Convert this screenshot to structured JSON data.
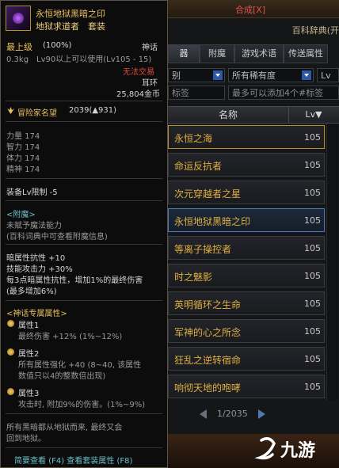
{
  "right_panel": {
    "title": "合成[X]",
    "subtitle": "百科辞典(开",
    "tabs": [
      "器",
      "附魔",
      "游戏术语",
      "传送属性"
    ],
    "filter_left": "别",
    "filter_mid": "所有稀有度",
    "filter_right": "Lv",
    "search_left": "标签",
    "search_right": "最多可以添加4个#标签",
    "col_name": "名称",
    "col_lv": "Lv▼",
    "rows": [
      {
        "name": "永恒之海",
        "lv": "105"
      },
      {
        "name": "命运反抗者",
        "lv": "105"
      },
      {
        "name": "次元穿越者之星",
        "lv": "105"
      },
      {
        "name": "永恒地狱黑暗之印",
        "lv": "105"
      },
      {
        "name": "等离子操控者",
        "lv": "105"
      },
      {
        "name": "时之魅影",
        "lv": "105"
      },
      {
        "name": "英明循环之生命",
        "lv": "105"
      },
      {
        "name": "军神的心之所念",
        "lv": "105"
      },
      {
        "name": "狂乱之逆转宿命",
        "lv": "105"
      },
      {
        "name": "响彻天地的咆哮",
        "lv": "105"
      }
    ],
    "pager": "1/2035"
  },
  "tooltip": {
    "item_name": "永恒地狱黑暗之印",
    "set_line": "地狱求道者　套装",
    "grade": "最上级",
    "grade_pct": "(100%)",
    "rarity": "神话",
    "weight_level": "0.3kg　Lv90以上可以使用(Lv105 - 15)",
    "trade": "无法交易",
    "slot": "耳环",
    "price": "25,804金币",
    "fame_label": "冒险家名望",
    "fame_value": "2039(▲931)",
    "stats": [
      "力量 174",
      "智力 174",
      "体力 174",
      "精神 174"
    ],
    "equip_limit": "装备Lv限制 -5",
    "enchant_title": "<附魔>",
    "enchant_l1": "未赋予魔法能力",
    "enchant_l2": "(百科词典中可查看附魔信息)",
    "effects": [
      "暗属性抗性 +10",
      "技能攻击力 +30%",
      "每3点暗属性抗性，增加1%的最终伤害",
      "(最多增加6%)"
    ],
    "myth_title": "<神话专属属性>",
    "myth": [
      {
        "name": "属性1",
        "desc": "最终伤害 +12% (1%~12%)"
      },
      {
        "name": "属性2",
        "desc": "所有属性强化 +40 (8~40, 该属性",
        "desc2": "数值只以4的整数倍出现)"
      },
      {
        "name": "属性3",
        "desc": "攻击时, 附加9%的伤害。(1%~9%)"
      }
    ],
    "flavor_1": "所有黑暗都从地狱而来, 最终又会",
    "flavor_2": "回到地狱。",
    "footer": "简要查看 (F4) 查看套装属性 (F8)"
  },
  "watermark": "九游",
  "colors": {
    "gold": "#e8c060",
    "red": "#e04a3a",
    "cyan": "#6ac0c8",
    "blue_select": "#4a7ab8"
  }
}
